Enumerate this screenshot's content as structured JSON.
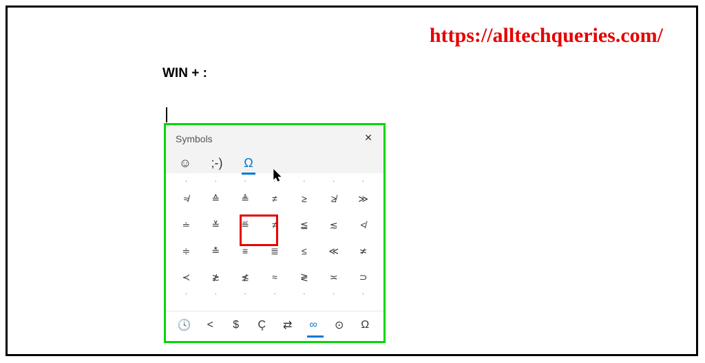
{
  "watermark": "https://alltechqueries.com/",
  "shortcut": "WIN + :",
  "panel": {
    "title": "Symbols",
    "close_label": "✕",
    "tabs": {
      "emoji": "☺",
      "kaomoji": ";-)",
      "symbols": "Ω"
    },
    "grid": [
      [
        "·",
        "·",
        "·",
        "·",
        "·",
        "·",
        "·"
      ],
      [
        "≉",
        "≙",
        "≜",
        "≠",
        "≥",
        "≱",
        "≫"
      ],
      [
        "≐",
        "≚",
        "≝",
        "≠",
        "≦",
        "≲",
        "≮"
      ],
      [
        "≑",
        "≛",
        "≡",
        "≣",
        "≤",
        "≪",
        "≭"
      ],
      [
        "≺",
        "≵",
        "≴",
        "≈",
        "≷",
        "≍",
        "⊃"
      ],
      [
        "·",
        "·",
        "·",
        "·",
        "·",
        "·",
        "·"
      ]
    ],
    "categories": [
      "🕓",
      "<",
      "$",
      "Ç",
      "⇄",
      "∞",
      "⊙",
      "Ω"
    ]
  }
}
